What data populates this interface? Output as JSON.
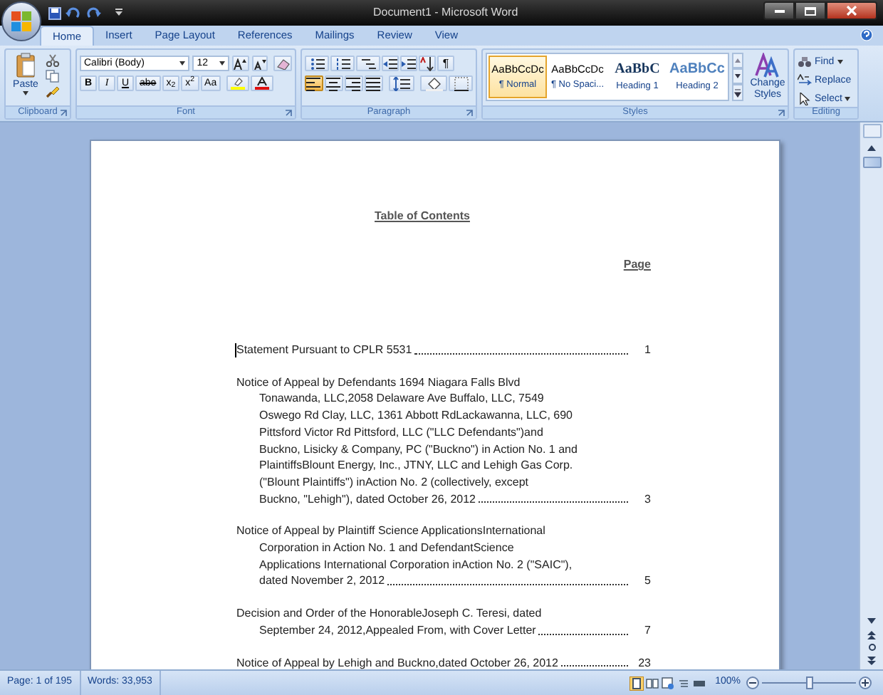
{
  "window": {
    "title": "Document1 - Microsoft Word"
  },
  "tabs": [
    {
      "label": "Home",
      "selected": true
    },
    {
      "label": "Insert",
      "selected": false
    },
    {
      "label": "Page Layout",
      "selected": false
    },
    {
      "label": "References",
      "selected": false
    },
    {
      "label": "Mailings",
      "selected": false
    },
    {
      "label": "Review",
      "selected": false
    },
    {
      "label": "View",
      "selected": false
    }
  ],
  "ribbon": {
    "clipboard": {
      "label": "Clipboard",
      "paste": "Paste"
    },
    "font": {
      "label": "Font",
      "font_name": "Calibri (Body)",
      "font_size": "12",
      "format_buttons": [
        {
          "kind": "bold",
          "text": "B"
        },
        {
          "kind": "italic",
          "text": "I"
        },
        {
          "kind": "underline",
          "text": "U"
        },
        {
          "kind": "strike",
          "text": "abe"
        },
        {
          "kind": "sub",
          "text": "x$_{2}$"
        },
        {
          "kind": "sup",
          "text": "x$^{2}$"
        },
        {
          "kind": "case",
          "text": "Aa"
        }
      ]
    },
    "paragraph": {
      "label": "Paragraph",
      "show_marks": "¶",
      "alignments": [
        {
          "kind": "left",
          "selected": true
        },
        {
          "kind": "center",
          "selected": false
        },
        {
          "kind": "right",
          "selected": false
        },
        {
          "kind": "justify",
          "selected": false
        }
      ]
    },
    "styles": {
      "label": "Styles",
      "gallery": [
        {
          "kind": "body",
          "sample": "AaBbCcDc",
          "name": "¶ Normal",
          "selected": true
        },
        {
          "kind": "body",
          "sample": "AaBbCcDc",
          "name": "¶ No Spaci...",
          "selected": false
        },
        {
          "kind": "heading",
          "sample": "AaBbC",
          "name": "Heading 1",
          "selected": false
        },
        {
          "kind": "heading2",
          "sample": "AaBbCc",
          "name": "Heading 2",
          "selected": false
        }
      ],
      "change_styles": "Change Styles"
    },
    "editing": {
      "label": "Editing",
      "buttons": [
        {
          "kind": "find",
          "text": "Find"
        },
        {
          "kind": "replace",
          "text": "Replace"
        },
        {
          "kind": "select",
          "text": "Select"
        }
      ]
    }
  },
  "document": {
    "heading": "Table of Contents",
    "page_label": "Page",
    "entries": [
      {
        "lines": [
          "Statement Pursuant to CPLR 5531"
        ],
        "page": "1"
      },
      {
        "lines": [
          "Notice of Appeal by Defendants 1694 Niagara Falls Blvd",
          "Tonawanda, LLC,2058 Delaware Ave Buffalo, LLC, 7549",
          "Oswego Rd Clay, LLC, 1361 Abbott  RdLackawanna, LLC, 690",
          "Pittsford Victor Rd Pittsford, LLC (\"LLC Defendants\")and",
          "Buckno, Lisicky & Company, PC (\"Buckno\") in Action No. 1 and",
          "PlaintiffsBlount Energy, Inc., JTNY, LLC and Lehigh Gas Corp.",
          "(\"Blount Plaintiffs\") inAction No. 2 (collectively, except",
          "Buckno, \"Lehigh\"), dated October 26, 2012"
        ],
        "page": "3"
      },
      {
        "lines": [
          "Notice of Appeal by Plaintiff Science ApplicationsInternational",
          "Corporation in Action No. 1 and DefendantScience",
          "Applications International Corporation inAction No. 2 (\"SAIC\"),",
          "dated November 2, 2012"
        ],
        "page": "5"
      },
      {
        "lines": [
          "Decision and Order of the HonorableJoseph  C. Teresi, dated",
          "September 24, 2012,Appealed From, with Cover Letter"
        ],
        "page": "7"
      },
      {
        "lines": [
          "Notice of Appeal by Lehigh and Buckno,dated October 26, 2012"
        ],
        "page": "23"
      }
    ]
  },
  "status_bar": {
    "page": "Page: 1 of 195",
    "words": "Words: 33,953",
    "zoom": "100%",
    "zoom_slider": {
      "level": 0.5
    }
  }
}
